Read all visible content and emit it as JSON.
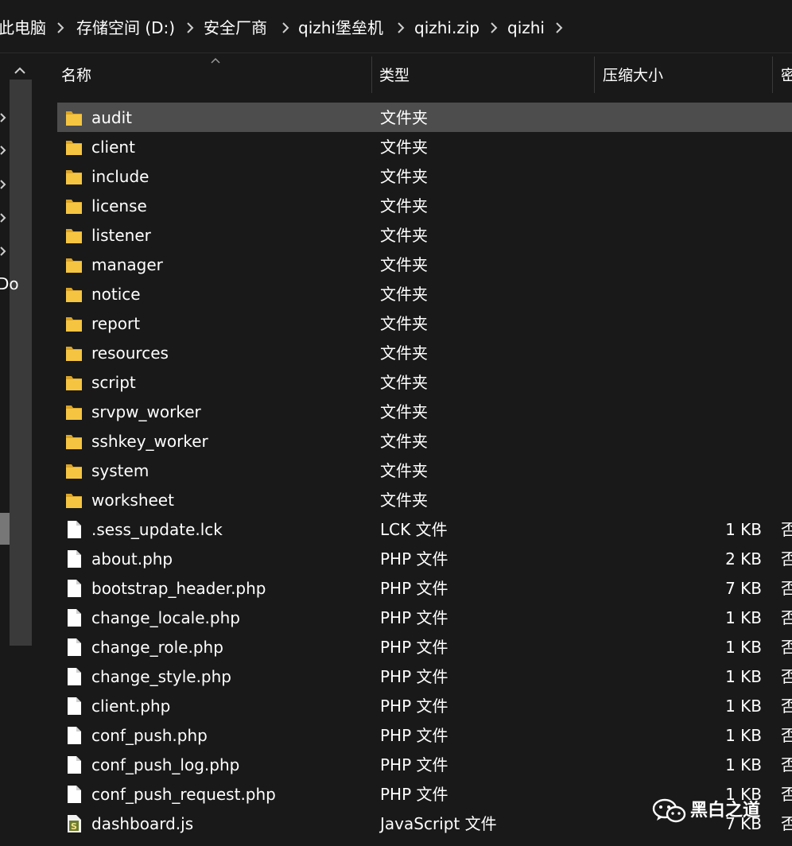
{
  "breadcrumb": [
    {
      "label": "此电脑"
    },
    {
      "label": "存储空间 (D:)"
    },
    {
      "label": "安全厂商"
    },
    {
      "label": "qizhi堡垒机"
    },
    {
      "label": "qizhi.zip"
    },
    {
      "label": "qizhi"
    }
  ],
  "nav": {
    "fragment": "Do"
  },
  "columns": {
    "name": "名称",
    "type": "类型",
    "compressed_size": "压缩大小",
    "encrypted": "密"
  },
  "rows": [
    {
      "name": "audit",
      "type": "文件夹",
      "size": "",
      "encrypted": "",
      "icon": "folder-icon",
      "selected": true
    },
    {
      "name": "client",
      "type": "文件夹",
      "size": "",
      "encrypted": "",
      "icon": "folder-icon"
    },
    {
      "name": "include",
      "type": "文件夹",
      "size": "",
      "encrypted": "",
      "icon": "folder-icon"
    },
    {
      "name": "license",
      "type": "文件夹",
      "size": "",
      "encrypted": "",
      "icon": "folder-icon"
    },
    {
      "name": "listener",
      "type": "文件夹",
      "size": "",
      "encrypted": "",
      "icon": "folder-icon"
    },
    {
      "name": "manager",
      "type": "文件夹",
      "size": "",
      "encrypted": "",
      "icon": "folder-icon"
    },
    {
      "name": "notice",
      "type": "文件夹",
      "size": "",
      "encrypted": "",
      "icon": "folder-icon"
    },
    {
      "name": "report",
      "type": "文件夹",
      "size": "",
      "encrypted": "",
      "icon": "folder-icon"
    },
    {
      "name": "resources",
      "type": "文件夹",
      "size": "",
      "encrypted": "",
      "icon": "folder-icon"
    },
    {
      "name": "script",
      "type": "文件夹",
      "size": "",
      "encrypted": "",
      "icon": "folder-icon"
    },
    {
      "name": "srvpw_worker",
      "type": "文件夹",
      "size": "",
      "encrypted": "",
      "icon": "folder-icon"
    },
    {
      "name": "sshkey_worker",
      "type": "文件夹",
      "size": "",
      "encrypted": "",
      "icon": "folder-icon"
    },
    {
      "name": "system",
      "type": "文件夹",
      "size": "",
      "encrypted": "",
      "icon": "folder-icon"
    },
    {
      "name": "worksheet",
      "type": "文件夹",
      "size": "",
      "encrypted": "",
      "icon": "folder-icon"
    },
    {
      "name": ".sess_update.lck",
      "type": "LCK 文件",
      "size": "1 KB",
      "encrypted": "否",
      "icon": "file-icon"
    },
    {
      "name": "about.php",
      "type": "PHP 文件",
      "size": "2 KB",
      "encrypted": "否",
      "icon": "file-icon"
    },
    {
      "name": "bootstrap_header.php",
      "type": "PHP 文件",
      "size": "7 KB",
      "encrypted": "否",
      "icon": "file-icon"
    },
    {
      "name": "change_locale.php",
      "type": "PHP 文件",
      "size": "1 KB",
      "encrypted": "否",
      "icon": "file-icon"
    },
    {
      "name": "change_role.php",
      "type": "PHP 文件",
      "size": "1 KB",
      "encrypted": "否",
      "icon": "file-icon"
    },
    {
      "name": "change_style.php",
      "type": "PHP 文件",
      "size": "1 KB",
      "encrypted": "否",
      "icon": "file-icon"
    },
    {
      "name": "client.php",
      "type": "PHP 文件",
      "size": "1 KB",
      "encrypted": "否",
      "icon": "file-icon"
    },
    {
      "name": "conf_push.php",
      "type": "PHP 文件",
      "size": "1 KB",
      "encrypted": "否",
      "icon": "file-icon"
    },
    {
      "name": "conf_push_log.php",
      "type": "PHP 文件",
      "size": "1 KB",
      "encrypted": "否",
      "icon": "file-icon"
    },
    {
      "name": "conf_push_request.php",
      "type": "PHP 文件",
      "size": "1 KB",
      "encrypted": "否",
      "icon": "file-icon"
    },
    {
      "name": "dashboard.js",
      "type": "JavaScript 文件",
      "size": "7 KB",
      "encrypted": "否",
      "icon": "js-file-icon"
    }
  ],
  "watermark": {
    "text": "黑白之道",
    "icon": "wechat-icon"
  },
  "colors": {
    "background": "#191919",
    "selected_row": "#4d4d4d",
    "folder": "#f5c542",
    "text": "#ffffff"
  }
}
